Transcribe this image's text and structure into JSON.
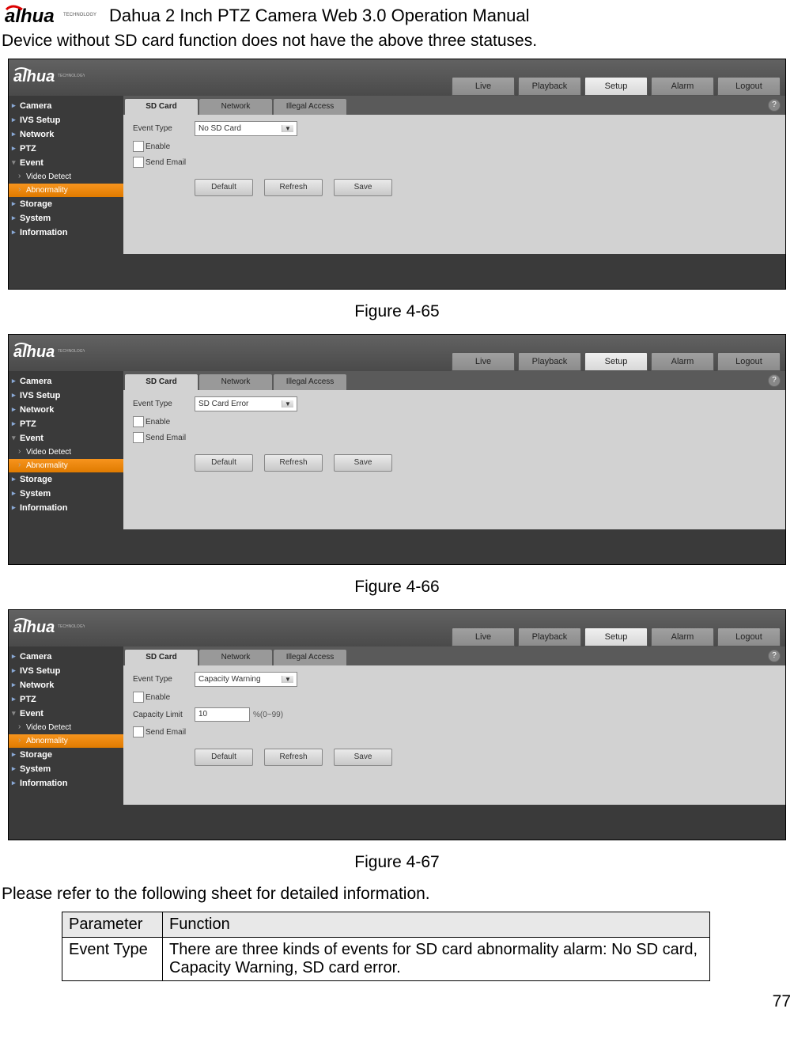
{
  "header": {
    "manual_title": "Dahua 2 Inch PTZ Camera Web 3.0 Operation Manual",
    "intro_line": "Device without SD card function does not have the above three statuses."
  },
  "nav": {
    "live": "Live",
    "playback": "Playback",
    "setup": "Setup",
    "alarm": "Alarm",
    "logout": "Logout"
  },
  "sidebar": {
    "camera": "Camera",
    "ivs": "IVS Setup",
    "network": "Network",
    "ptz": "PTZ",
    "event": "Event",
    "video_detect": "Video Detect",
    "abnormality": "Abnormality",
    "storage": "Storage",
    "system": "System",
    "information": "Information"
  },
  "tabs": {
    "sdcard": "SD Card",
    "network": "Network",
    "illegal": "Illegal Access"
  },
  "form": {
    "event_type": "Event Type",
    "enable": "Enable",
    "send_email": "Send Email",
    "capacity_limit": "Capacity Limit",
    "capacity_hint": "%(0~99)",
    "default": "Default",
    "refresh": "Refresh",
    "save": "Save",
    "help_symbol": "?"
  },
  "fig1": {
    "caption": "Figure 4-65",
    "event_value": "No SD Card"
  },
  "fig2": {
    "caption": "Figure 4-66",
    "event_value": "SD Card Error"
  },
  "fig3": {
    "caption": "Figure 4-67",
    "event_value": "Capacity Warning",
    "capacity_value": "10"
  },
  "refer_line": "Please refer to the following sheet for detailed information.",
  "table": {
    "h_param": "Parameter",
    "h_func": "Function",
    "r1_param": "Event Type",
    "r1_func": "There are three kinds of events for SD card abnormality alarm: No SD card, Capacity Warning, SD card error."
  },
  "page_number": "77"
}
